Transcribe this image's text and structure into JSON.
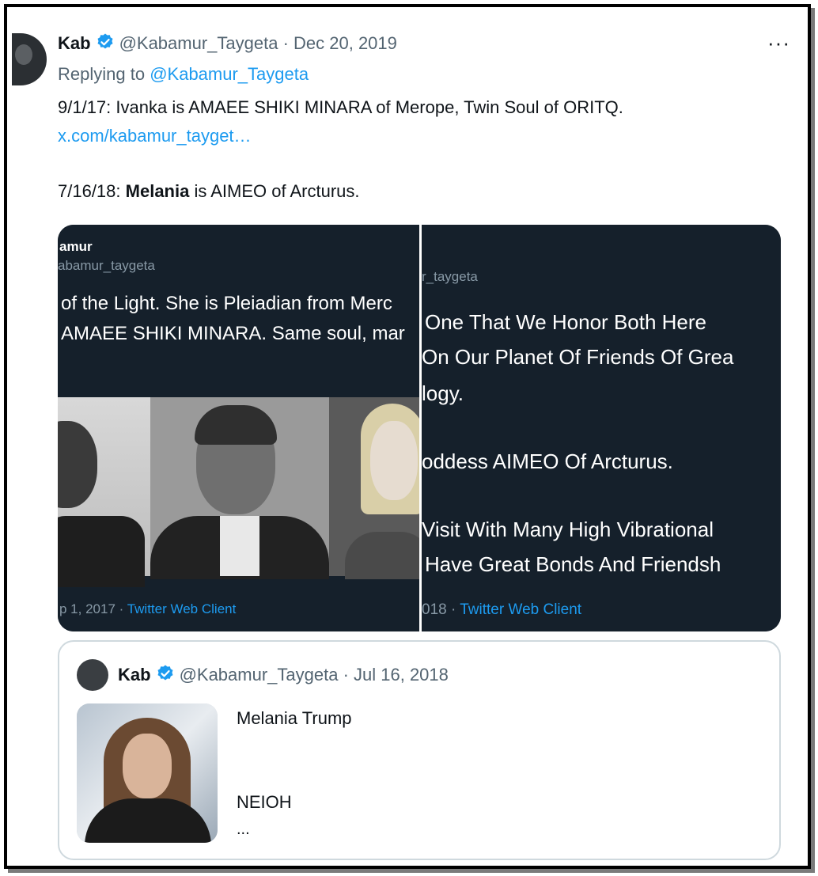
{
  "tweet": {
    "author_name": "Kab",
    "author_handle": "@Kabamur_Taygeta",
    "date": "Dec 20, 2019",
    "replying_to_label": "Replying to",
    "replying_to_handle": "@Kabamur_Taygeta",
    "line1": "9/1/17: Ivanka is AMAEE SHIKI MINARA of Merope, Twin Soul of ORITQ.",
    "link": "x.com/kabamur_tayget…",
    "line3_prefix": "7/16/18: ",
    "line3_bold": "Melania",
    "line3_suffix": " is AIMEO of Arcturus.",
    "more_label": "···"
  },
  "media": {
    "left": {
      "name": "amur",
      "handle": "abamur_taygeta",
      "text1": "of the Light. She is Pleiadian from Merc",
      "text2": "AMAEE SHIKI MINARA. Same soul, mar",
      "foot_date": "p 1, 2017 · ",
      "foot_client": "Twitter Web Client"
    },
    "right": {
      "handle": "r_taygeta",
      "lines": [
        "One That We Honor Both Here",
        "On Our Planet Of Friends Of Grea",
        "logy.",
        "oddess AIMEO Of Arcturus.",
        "Visit With Many High Vibrational",
        "Have Great Bonds And Friendsh"
      ],
      "foot_date": "018 · ",
      "foot_client": "Twitter Web Client"
    }
  },
  "quote": {
    "author_name": "Kab",
    "author_handle": "@Kabamur_Taygeta",
    "date": "Jul 16, 2018",
    "title": "Melania Trump",
    "subtitle": "NEIOH",
    "ellipsis": "..."
  },
  "colors": {
    "link": "#1d9bf0",
    "verified": "#1d9bf0",
    "media_bg": "#15202b"
  }
}
